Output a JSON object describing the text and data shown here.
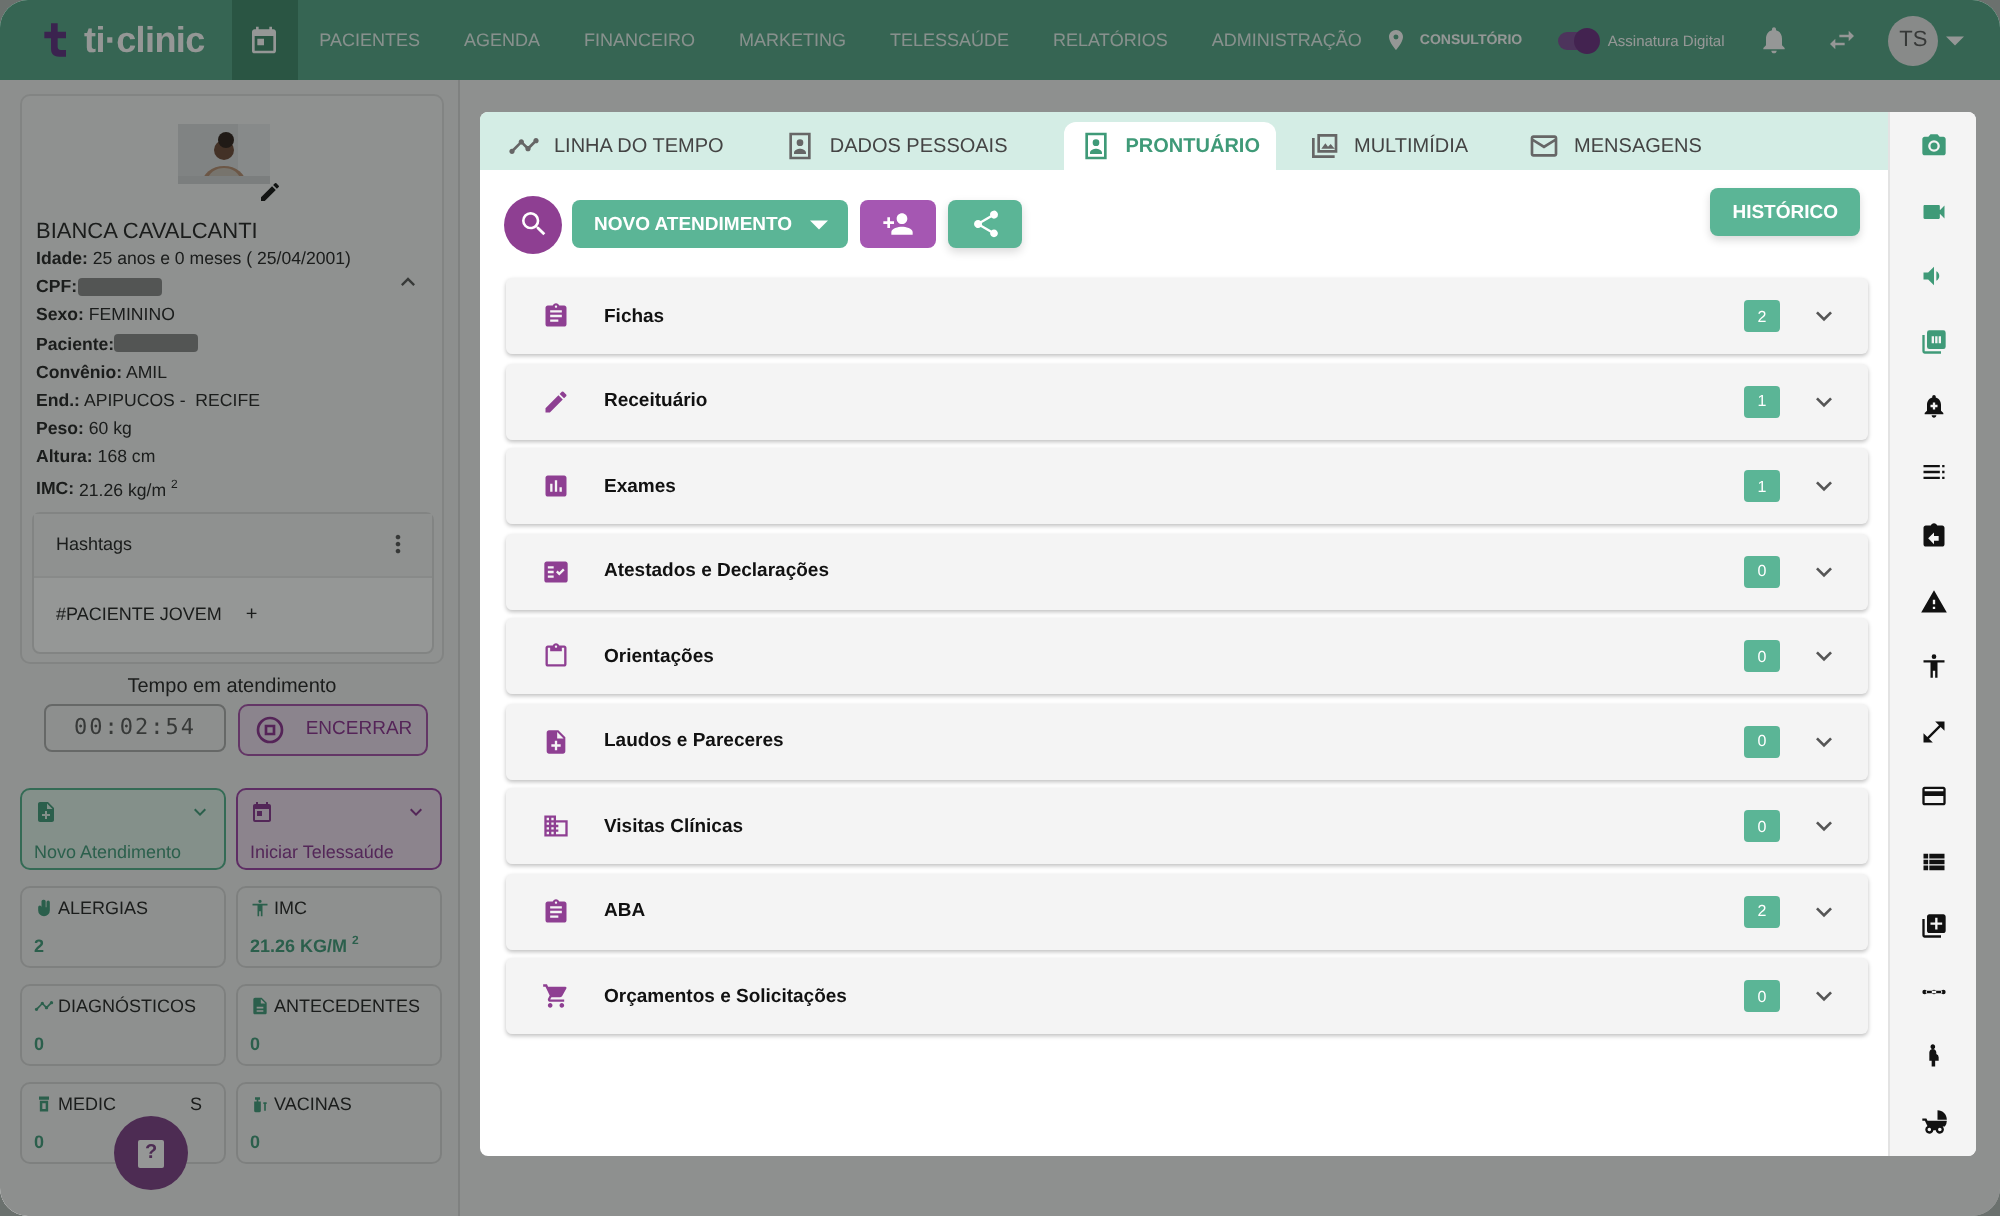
{
  "header": {
    "logo": "ti·clinic",
    "nav": [
      {
        "kind": "icon",
        "selected": true
      },
      {
        "kind": "text",
        "label": "PACIENTES",
        "selected": false
      },
      {
        "kind": "text",
        "label": "AGENDA",
        "selected": false
      },
      {
        "kind": "text",
        "label": "FINANCEIRO",
        "selected": false
      },
      {
        "kind": "text",
        "label": "MARKETING",
        "selected": false
      },
      {
        "kind": "text",
        "label": "TELESSAÚDE",
        "selected": false
      },
      {
        "kind": "text",
        "label": "RELATÓRIOS",
        "selected": false
      },
      {
        "kind": "text",
        "label": "ADMINISTRAÇÃO",
        "selected": false
      }
    ],
    "location": "CONSULTÓRIO",
    "signature": {
      "label": "Assinatura Digital",
      "on": true
    },
    "avatar": "TS"
  },
  "patient": {
    "name": "BIANCA CAVALCANTI",
    "fields": [
      {
        "label": "Idade:",
        "value": "25 anos e 0 meses ( 25/04/2001)"
      },
      {
        "label": "CPF:",
        "redacted": true
      },
      {
        "label": "Sexo:",
        "value": "FEMININO"
      },
      {
        "label": "Paciente:",
        "redacted": true
      },
      {
        "label": "Convênio:",
        "value": "AMIL"
      },
      {
        "label": "End.:",
        "value": "APIPUCOS -  RECIFE"
      },
      {
        "label": "Peso:",
        "value": "60 kg"
      },
      {
        "label": "Altura:",
        "value": "168 cm"
      },
      {
        "label": "IMC:",
        "value": "21.26 kg/m $^{2}$"
      }
    ],
    "expanded": true,
    "hashtags": {
      "title": "Hashtags",
      "tags": [
        "#PACIENTE JOVEM"
      ],
      "add": "+"
    }
  },
  "timer": {
    "label": "Tempo em atendimento",
    "value": "00:02:54",
    "button": "ENCERRAR"
  },
  "actions": [
    {
      "kind": "green",
      "label": "Novo Atendimento"
    },
    {
      "kind": "purple",
      "label": "Iniciar Telessaúde"
    }
  ],
  "stats": [
    {
      "label": "ALERGIAS",
      "value": "2"
    },
    {
      "label": "IMC",
      "value": "21.26 KG/M $^{2}$"
    },
    {
      "label": "DIAGNÓSTICOS",
      "value": "0"
    },
    {
      "label": "ANTECEDENTES",
      "value": "0"
    },
    {
      "label": "MEDIC",
      "label_end": "S",
      "value": "0"
    },
    {
      "label": "VACINAS",
      "value": "0"
    }
  ],
  "help_button": "?",
  "panel": {
    "tabs": [
      {
        "label": "LINHA DO TEMPO",
        "selected": false
      },
      {
        "label": "DADOS PESSOAIS",
        "selected": false
      },
      {
        "label": "PRONTUÁRIO",
        "selected": true
      },
      {
        "label": "MULTIMÍDIA",
        "selected": false
      },
      {
        "label": "MENSAGENS",
        "selected": false
      }
    ],
    "new_button": "NOVO ATENDIMENTO",
    "history_button": "HISTÓRICO",
    "sections": [
      {
        "label": "Fichas",
        "count": "2"
      },
      {
        "label": "Receituário",
        "count": "1"
      },
      {
        "label": "Exames",
        "count": "1"
      },
      {
        "label": "Atestados e Declarações",
        "count": "0"
      },
      {
        "label": "Orientações",
        "count": "0"
      },
      {
        "label": "Laudos e Pareceres",
        "count": "0"
      },
      {
        "label": "Visitas Clínicas",
        "count": "0"
      },
      {
        "label": "ABA",
        "count": "2"
      },
      {
        "label": "Orçamentos e Solicitações",
        "count": "0"
      }
    ]
  }
}
